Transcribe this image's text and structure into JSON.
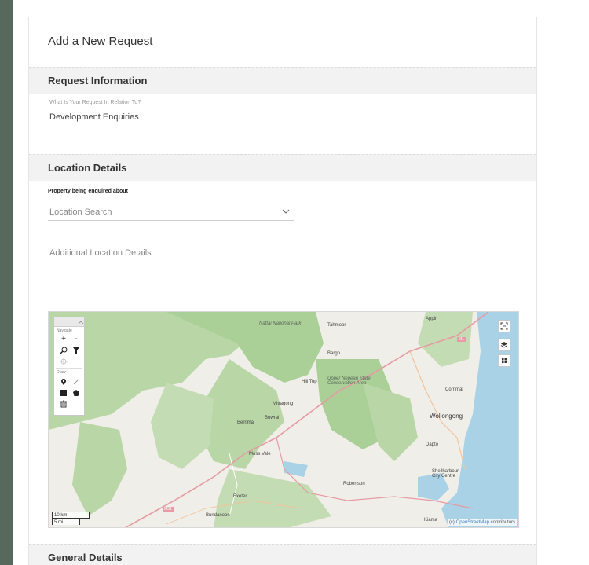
{
  "page": {
    "title": "Add a New Request"
  },
  "sections": {
    "request_info": "Request Information",
    "location_details": "Location Details",
    "general_details": "General Details"
  },
  "request": {
    "label": "What Is Your Request In Relation To?",
    "value": "Development Enquiries"
  },
  "location": {
    "property_label": "Property being enquired about",
    "search_placeholder": "Location Search",
    "additional_placeholder": "Additional Location Details"
  },
  "map": {
    "tools": {
      "navigate_label": "Navigate",
      "draw_label": "Draw",
      "zoom_in": "+",
      "zoom_out": "-"
    },
    "scale_km": "10 km",
    "scale_mi": "5 mi",
    "attribution_prefix": "(c)",
    "attribution_link": "OpenStreetMap",
    "attribution_suffix": "contributors",
    "places": {
      "national_park": "Nattai National Park",
      "upper_nepean": "Upper Nepean State Conservation Area",
      "wollongong": "Wollongong",
      "mittagong": "Mittagong",
      "bowral": "Bowral",
      "berrima": "Berrima",
      "moss_vale": "Moss Vale",
      "exeter": "Exeter",
      "bundanoon": "Bundanoon",
      "robertson": "Robertson",
      "bargo": "Bargo",
      "thirlmere": "Tahmoor",
      "hill_top": "Hill Top",
      "dapto": "Dapto",
      "shellharbour": "Shellharbour City Centre",
      "appin": "Appin",
      "corrimal": "Corrimal",
      "kiama": "Kiama",
      "m1": "M1",
      "m31": "M31"
    }
  }
}
